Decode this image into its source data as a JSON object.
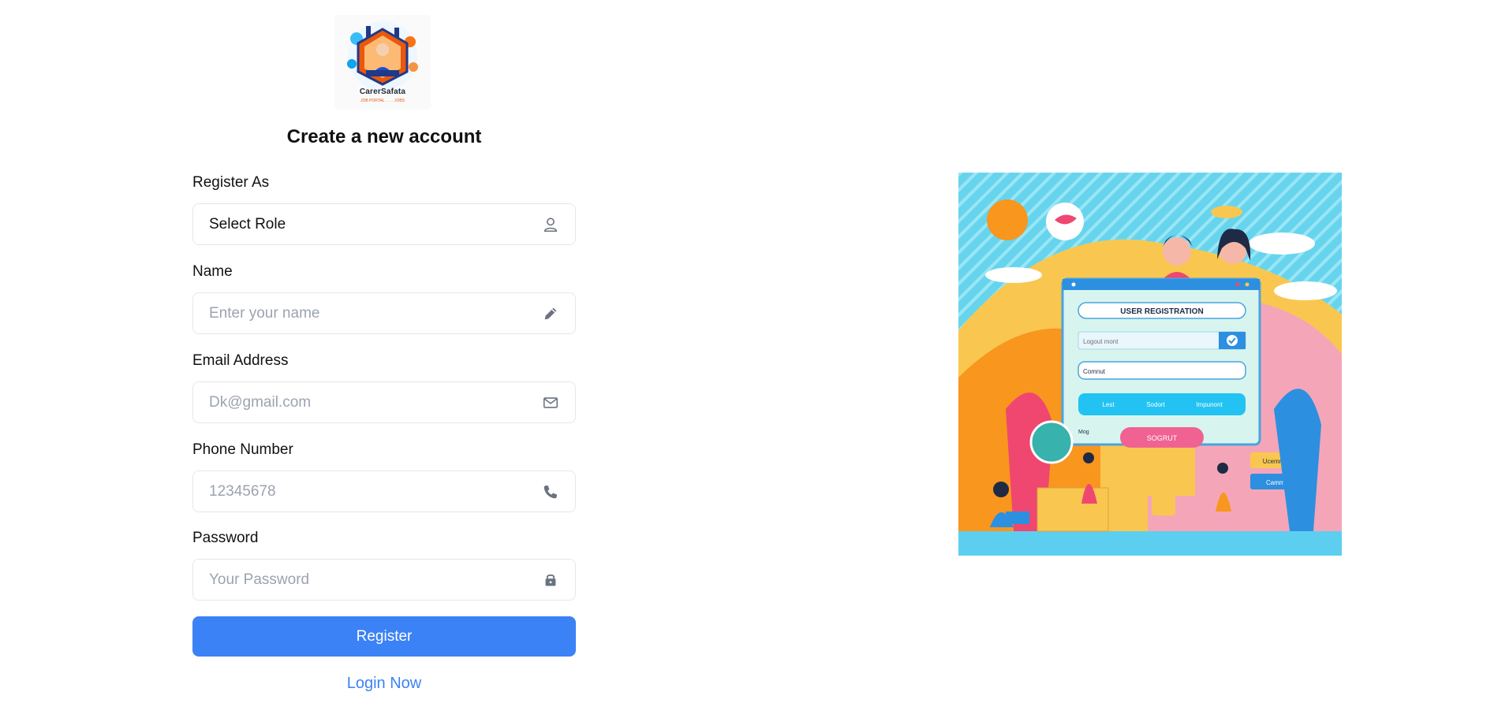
{
  "logo": {
    "brand_text": "CarerSafata",
    "sub_text": "JOB PORTAL . . . . JOBS"
  },
  "form": {
    "title": "Create a new account",
    "role": {
      "label": "Register As",
      "value": "Select Role",
      "icon": "user-icon"
    },
    "name": {
      "label": "Name",
      "placeholder": "Enter your name",
      "icon": "pencil-icon"
    },
    "email": {
      "label": "Email Address",
      "placeholder": "Dk@gmail.com",
      "icon": "envelope-icon"
    },
    "phone": {
      "label": "Phone Number",
      "placeholder": "12345678",
      "icon": "phone-icon"
    },
    "password": {
      "label": "Password",
      "placeholder": "Your Password",
      "icon": "lock-icon"
    },
    "submit_label": "Register",
    "login_link": "Login Now"
  },
  "illustration": {
    "heading": "USER REGISTRATION",
    "field1": "Logout mont",
    "field2": "Comnut",
    "tabs": [
      "Lest",
      "Sodort",
      "Impunont"
    ],
    "button": "SOGRUT",
    "side_label": "Mog",
    "card1": "Ucemmun",
    "card2": "Cammu"
  },
  "colors": {
    "accent": "#3b82f6",
    "border": "#e5e7eb",
    "placeholder": "#9ca3af"
  }
}
